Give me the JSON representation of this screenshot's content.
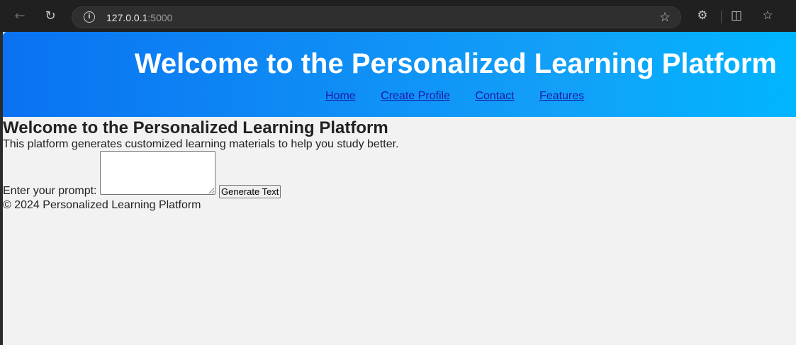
{
  "browser": {
    "url_host": "127.0.0.1",
    "url_port": ":5000",
    "icons": {
      "back": "arrow-left",
      "reload": "reload",
      "info": "info-circle",
      "favorite": "star-outline",
      "extensions": "puzzle",
      "split_screen": "split-screen",
      "favorites_bar": "star-list"
    }
  },
  "header": {
    "title": "Welcome to the Personalized Learning Platform",
    "nav": [
      {
        "label": "Home"
      },
      {
        "label": "Create Profile"
      },
      {
        "label": "Contact"
      },
      {
        "label": "Features"
      }
    ],
    "gradient_start": "#0a72f2",
    "gradient_end": "#00b5ff",
    "link_color": "#1a1aa6"
  },
  "main": {
    "heading": "Welcome to the Personalized Learning Platform",
    "description": "This platform generates customized learning materials to help you study better.",
    "prompt_label": "Enter your prompt:",
    "prompt_value": "",
    "generate_button": "Generate Text"
  },
  "footer": {
    "text": "© 2024 Personalized Learning Platform"
  }
}
